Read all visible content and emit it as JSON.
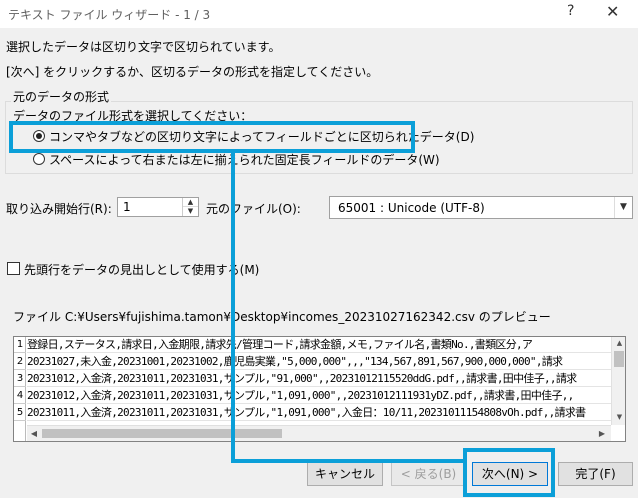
{
  "window": {
    "title": "テキスト ファイル ウィザード - 1 / 3",
    "help_label": "?",
    "close_label": "✕"
  },
  "instructions": {
    "line1": "選択したデータは区切り文字で区切られています。",
    "line2": "[次へ] をクリックするか、区切るデータの形式を指定してください。"
  },
  "format_group": {
    "label": "元のデータの形式",
    "prompt": "データのファイル形式を選択してください：",
    "options": [
      {
        "label": "コンマやタブなどの区切り文字によってフィールドごとに区切られたデータ(D)",
        "selected": true
      },
      {
        "label": "スペースによって右または左に揃えられた固定長フィールドのデータ(W)",
        "selected": false
      }
    ]
  },
  "start_row": {
    "label": "取り込み開始行(R):",
    "value": "1"
  },
  "origin": {
    "label": "元のファイル(O):",
    "value": "65001 : Unicode (UTF-8)"
  },
  "header_checkbox": {
    "label": "先頭行をデータの見出しとして使用する(M)",
    "checked": false
  },
  "preview": {
    "caption": "ファイル C:¥Users¥fujishima.tamon¥Desktop¥incomes_20231027162342.csv のプレビュー",
    "line_numbers": [
      "1",
      "2",
      "3",
      "4",
      "5"
    ],
    "rows": [
      "登録日,ステータス,請求日,入金期限,請求先/管理コード,請求金額,メモ,ファイル名,書類No.,書類区分,ア",
      "20231027,未入金,20231001,20231002,鹿児島実業,\"5,000,000\",,,\"134,567,891,567,900,000,000\",請求",
      "20231012,入金済,20231011,20231031,サンプル,\"91,000\",,20231012115520ddG.pdf,,請求書,田中佳子,,請求",
      "20231012,入金済,20231011,20231031,サンプル,\"1,091,000\",,20231012111931yDZ.pdf,,請求書,田中佳子,,",
      "20231011,入金済,20231011,20231031,サンプル,\"1,091,000\",入金日：10/11,20231011154808vOh.pdf,,請求書"
    ]
  },
  "buttons": {
    "cancel": "キャンセル",
    "back": "< 戻る(B)",
    "next": "次へ(N) >",
    "finish": "完了(F)"
  },
  "colors": {
    "highlight": "#0b9fd8",
    "primary_border": "#0078d7"
  },
  "icons": {
    "spin_up": "triangle-up-icon",
    "spin_down": "triangle-down-icon",
    "dropdown": "chevron-down-icon",
    "scroll_arrows": "triangle-icons"
  }
}
